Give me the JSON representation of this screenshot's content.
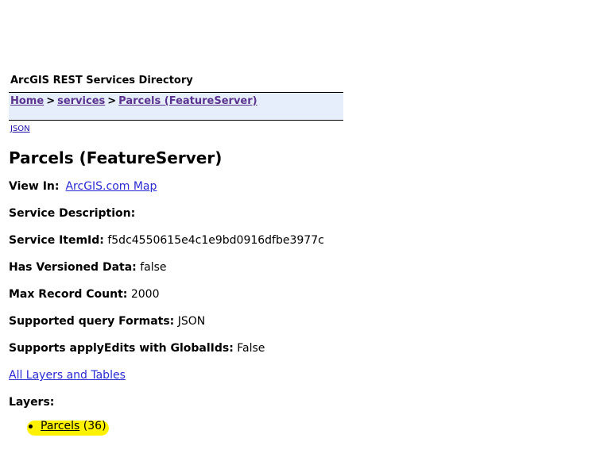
{
  "directory_title": "ArcGIS REST Services Directory",
  "breadcrumb": {
    "home": "Home",
    "sep1": ">",
    "services": "services",
    "sep2": ">",
    "current": "Parcels (FeatureServer)"
  },
  "json_link": "JSON",
  "page_title": "Parcels (FeatureServer)",
  "view_in": {
    "label": "View In:",
    "link": "ArcGIS.com Map"
  },
  "service_description": {
    "label": "Service Description:"
  },
  "service_item_id": {
    "label": "Service ItemId:",
    "value": "f5dc4550615e4c1e9bd0916dfbe3977c"
  },
  "has_versioned_data": {
    "label": "Has Versioned Data:",
    "value": "false"
  },
  "max_record_count": {
    "label": "Max Record Count:",
    "value": "2000"
  },
  "supported_query_formats": {
    "label": "Supported query Formats:",
    "value": "JSON"
  },
  "supports_apply_edits": {
    "label": "Supports applyEdits with GlobalIds:",
    "value": "False"
  },
  "all_layers_link": "All Layers and Tables",
  "layers": {
    "label": "Layers:",
    "items": [
      {
        "name": "Parcels",
        "id": "(36)"
      }
    ]
  },
  "colors": {
    "nav_background": "#e5eefa",
    "visited_link": "#5a3390",
    "link": "#2a2ad6",
    "highlight": "#fff200"
  }
}
